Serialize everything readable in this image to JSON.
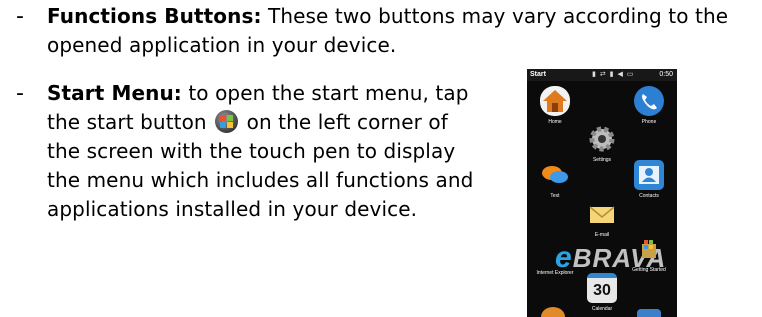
{
  "bullets": [
    {
      "dash": "-",
      "term": "Functions Buttons:",
      "text": " These two buttons may vary according to the opened application in your device."
    },
    {
      "dash": "-",
      "term": "Start Menu:",
      "text_before_icon": " to open the start menu, tap the start button ",
      "icon": "windows-start-icon",
      "text_after_icon": " on the left corner of the screen with the touch pen to display the menu which includes all functions and applications installed in your device."
    }
  ],
  "phone": {
    "status_title": "Start",
    "status_time": "0:50",
    "status_icons": [
      "signal-icon",
      "sync-icon",
      "signal-icon",
      "volume-icon",
      "battery-icon"
    ],
    "watermark": "BRAVA",
    "apps": [
      {
        "label": "Home",
        "icon": "house-icon",
        "color": "#e07a1f"
      },
      {
        "label": "Phone",
        "icon": "phone-icon",
        "color": "#2d7fd3"
      },
      {
        "label": "Settings",
        "icon": "gear-icon",
        "color": "#6b6b6b"
      },
      {
        "label": "Text",
        "icon": "chat-bubbles-icon",
        "color": "#f08a1a"
      },
      {
        "label": "Contacts",
        "icon": "contact-card-icon",
        "color": "#2f86d6"
      },
      {
        "label": "E-mail",
        "icon": "envelope-icon",
        "color": "#f4d57a"
      },
      {
        "label": "Internet Explorer",
        "icon": "internet-explorer-icon",
        "color": "#1e90e6"
      },
      {
        "label": "Getting Started",
        "icon": "getting-started-icon",
        "color": "#c9a04a"
      },
      {
        "label": "Calendar",
        "icon": "calendar-icon",
        "color": "#e8e8e8",
        "number": "30"
      }
    ]
  }
}
